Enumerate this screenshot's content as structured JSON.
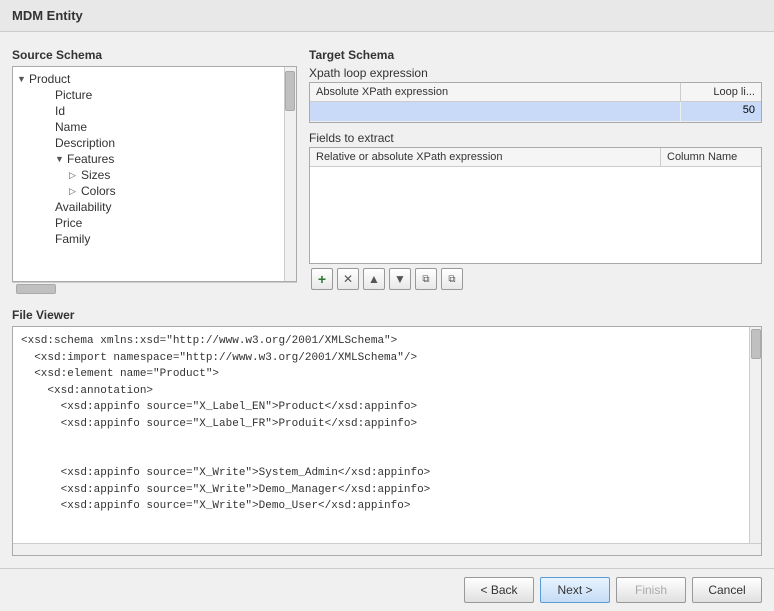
{
  "dialog": {
    "title": "MDM Entity"
  },
  "source_schema": {
    "label": "Source Schema",
    "tree": {
      "root": "Product",
      "children": [
        {
          "label": "Picture",
          "type": "leaf"
        },
        {
          "label": "Id",
          "type": "leaf"
        },
        {
          "label": "Name",
          "type": "leaf"
        },
        {
          "label": "Description",
          "type": "leaf"
        },
        {
          "label": "Features",
          "type": "group",
          "children": [
            {
              "label": "Sizes",
              "type": "subgroup"
            },
            {
              "label": "Colors",
              "type": "subgroup"
            }
          ]
        },
        {
          "label": "Availability",
          "type": "leaf"
        },
        {
          "label": "Price",
          "type": "leaf"
        },
        {
          "label": "Family",
          "type": "leaf"
        }
      ]
    }
  },
  "target_schema": {
    "label": "Target Schema",
    "xpath_section": {
      "label": "Xpath loop expression",
      "table": {
        "headers": [
          "Absolute XPath expression",
          "Loop li..."
        ],
        "rows": [
          {
            "xpath": "",
            "loop": "50",
            "selected": true
          }
        ]
      }
    },
    "fields_section": {
      "label": "Fields to extract",
      "table": {
        "headers": [
          "Relative or absolute XPath expression",
          "Column Name"
        ],
        "rows": []
      },
      "toolbar": {
        "add": "+",
        "delete": "×",
        "up": "▲",
        "down": "▼",
        "copy": "⧉",
        "paste": "⧉"
      }
    }
  },
  "file_viewer": {
    "label": "File Viewer",
    "content": "<xsd:schema xmlns:xsd=\"http://www.w3.org/2001/XMLSchema\">\n  <xsd:import namespace=\"http://www.w3.org/2001/XMLSchema\"/>\n  <xsd:element name=\"Product\">\n    <xsd:annotation>\n      <xsd:appinfo source=\"X_Label_EN\">Product</xsd:appinfo>\n      <xsd:appinfo source=\"X_Label_FR\">Produit</xsd:appinfo>\n\n\n      <xsd:appinfo source=\"X_Write\">System_Admin</xsd:appinfo>\n      <xsd:appinfo source=\"X_Write\">Demo_Manager</xsd:appinfo>\n      <xsd:appinfo source=\"X_Write\">Demo_User</xsd:appinfo>"
  },
  "footer": {
    "back_label": "< Back",
    "next_label": "Next >",
    "finish_label": "Finish",
    "cancel_label": "Cancel"
  }
}
